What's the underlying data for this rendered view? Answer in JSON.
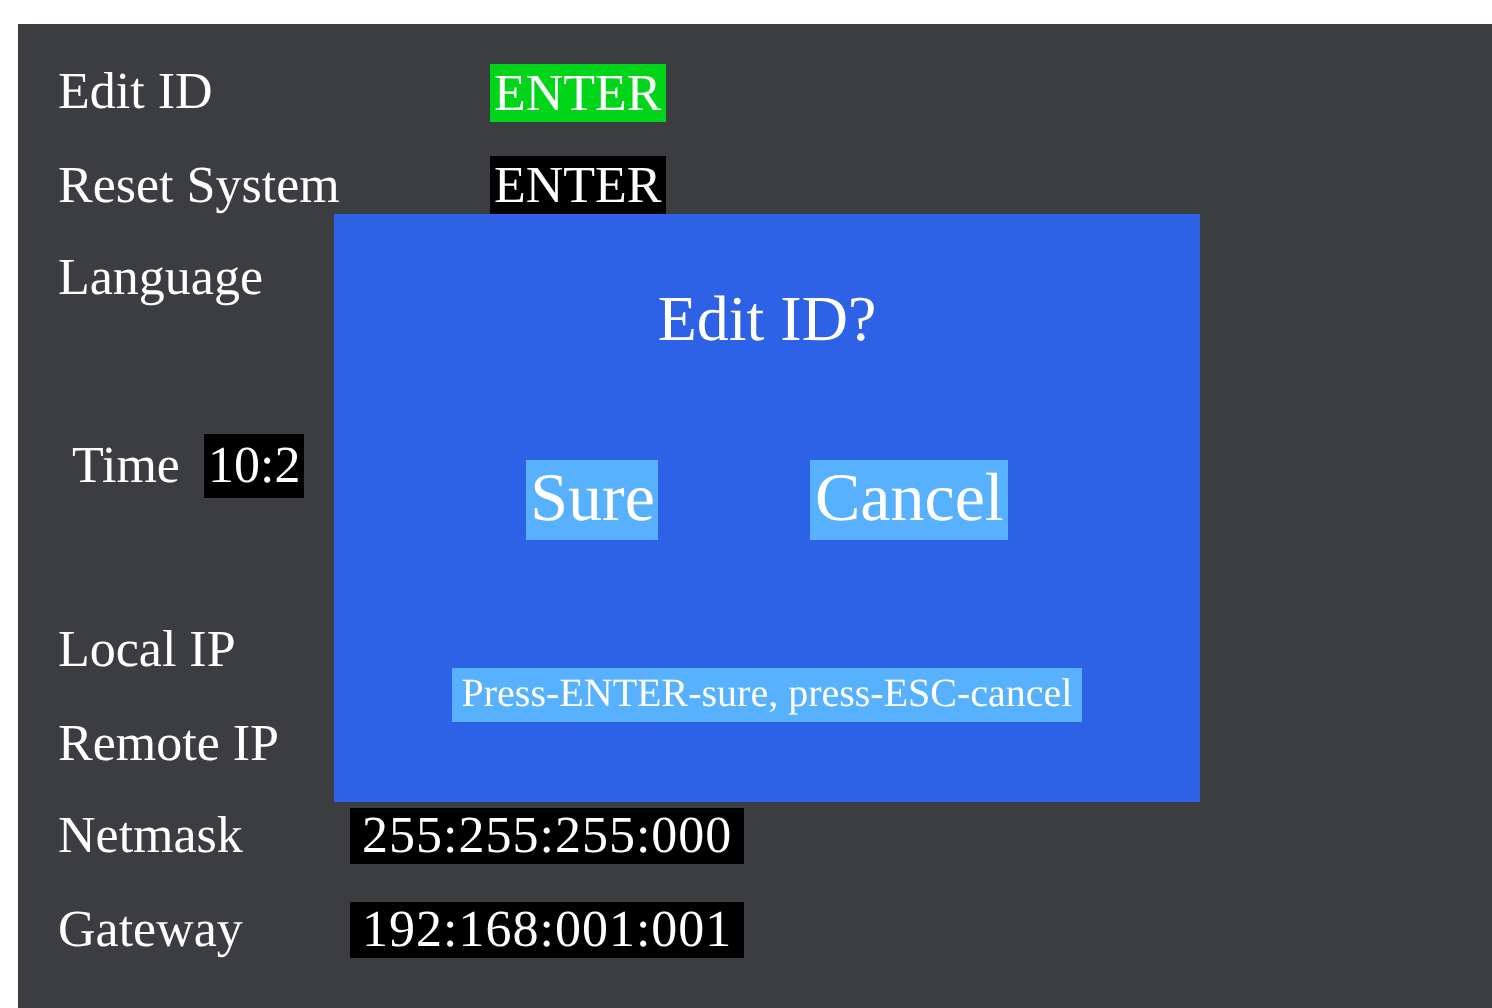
{
  "menu": [
    {
      "kind": "action",
      "label": "Edit ID",
      "value": "ENTER",
      "selected": true
    },
    {
      "kind": "action",
      "label": "Reset System",
      "value": "ENTER",
      "selected": false
    },
    {
      "kind": "plain",
      "label": "Language"
    },
    {
      "kind": "time",
      "label": "Time",
      "value": "10:2"
    },
    {
      "kind": "ip",
      "label": "Local IP"
    },
    {
      "kind": "ip",
      "label": "Remote IP"
    },
    {
      "kind": "ip",
      "label": "Netmask",
      "value": "255:255:255:000"
    },
    {
      "kind": "ip",
      "label": "Gateway",
      "value": "192:168:001:001"
    }
  ],
  "dialog": {
    "title": "Edit ID?",
    "buttons": [
      "Sure",
      "Cancel"
    ],
    "hint": "Press-ENTER-sure, press-ESC-cancel"
  }
}
